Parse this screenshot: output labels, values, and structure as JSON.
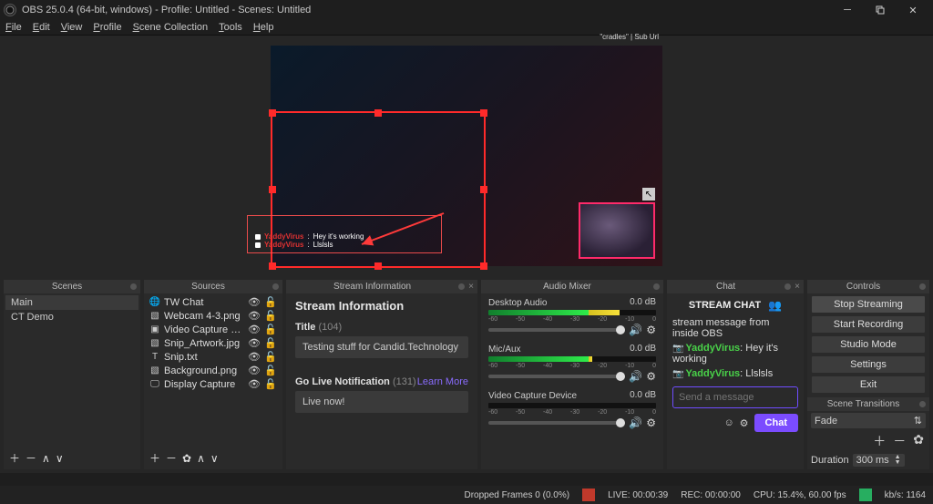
{
  "window": {
    "title": "OBS 25.0.4 (64-bit, windows) - Profile: Untitled - Scenes: Untitled"
  },
  "menu": [
    "File",
    "Edit",
    "View",
    "Profile",
    "Scene Collection",
    "Tools",
    "Help"
  ],
  "preview": {
    "webcam_label": "\"cradles\" | Sub Url",
    "chat_overlay": [
      {
        "user": "YaddyVirus",
        "msg": "Hey it's working"
      },
      {
        "user": "YaddyVirus",
        "msg": "Llslsls"
      }
    ]
  },
  "panels": {
    "scenes": {
      "title": "Scenes",
      "items": [
        "Main",
        "CT Demo"
      ]
    },
    "sources": {
      "title": "Sources",
      "items": [
        {
          "icon": "globe",
          "name": "TW Chat"
        },
        {
          "icon": "image",
          "name": "Webcam 4-3.png"
        },
        {
          "icon": "camera",
          "name": "Video Capture Device"
        },
        {
          "icon": "image",
          "name": "Snip_Artwork.jpg"
        },
        {
          "icon": "text",
          "name": "Snip.txt"
        },
        {
          "icon": "image",
          "name": "Background.png"
        },
        {
          "icon": "monitor",
          "name": "Display Capture"
        }
      ]
    },
    "stream_info": {
      "title": "Stream Information",
      "heading": "Stream Information",
      "title_label": "Title",
      "title_count": "(104)",
      "title_value": "Testing stuff for Candid.Technology",
      "live_label": "Go Live Notification",
      "live_count": "(131)",
      "learn_more": "Learn More",
      "live_value": "Live now!"
    },
    "mixer": {
      "title": "Audio Mixer",
      "channels": [
        {
          "name": "Desktop Audio",
          "db": "0.0 dB",
          "level": 0.78
        },
        {
          "name": "Mic/Aux",
          "db": "0.0 dB",
          "level": 0.62
        },
        {
          "name": "Video Capture Device",
          "db": "0.0 dB",
          "level": 0.0
        }
      ]
    },
    "chat": {
      "title": "Chat",
      "header": "STREAM CHAT",
      "system": "stream message from inside OBS",
      "messages": [
        {
          "user": "YaddyVirus",
          "msg": "Hey it's working"
        },
        {
          "user": "YaddyVirus",
          "msg": "Llslsls"
        }
      ],
      "placeholder": "Send a message",
      "send": "Chat"
    },
    "controls": {
      "title": "Controls",
      "buttons": [
        "Stop Streaming",
        "Start Recording",
        "Studio Mode",
        "Settings",
        "Exit"
      ],
      "transitions_title": "Scene Transitions",
      "transition": "Fade",
      "duration_label": "Duration",
      "duration_value": "300 ms"
    }
  },
  "status": {
    "dropped": "Dropped Frames 0 (0.0%)",
    "live": "LIVE: 00:00:39",
    "rec": "REC: 00:00:00",
    "cpu": "CPU: 15.4%, 60.00 fps",
    "kbps": "kb/s: 1164"
  }
}
